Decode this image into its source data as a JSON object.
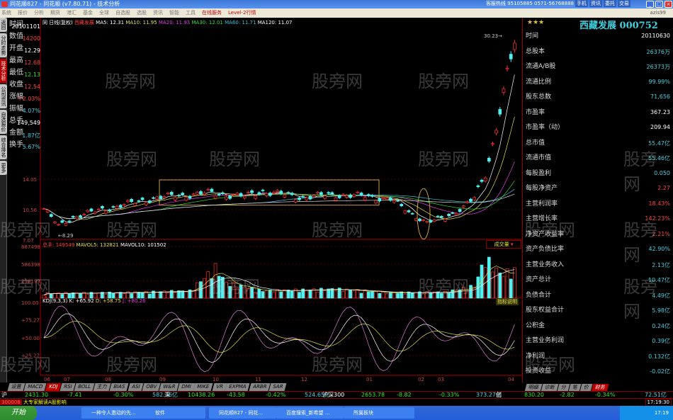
{
  "window": {
    "title": "同花顺827 - 同花顺 (v7.80.71) - 技术分析",
    "hotline": "客服热线 95105885 0571-56768888",
    "top_buttons": [
      "手机",
      "资讯",
      "委托",
      "交易"
    ],
    "user": "azis99"
  },
  "menu": [
    "系统",
    "报价",
    "分析",
    "期货",
    "港汇",
    "基金",
    "全球",
    "自选股",
    "选股",
    "资讯",
    "智能",
    "工具"
  ],
  "menu_hot": [
    "在线服务",
    "Level-2行情"
  ],
  "sidebar_tabs": [
    "返回",
    "分时走势",
    "技术分析",
    "公司资讯",
    "自选报价",
    "综合排名",
    "更多"
  ],
  "info": [
    {
      "label": "时间",
      "value": "20101101",
      "color": "#ffffff"
    },
    {
      "label": "数值",
      "value": "14200",
      "color": "#ff4040"
    },
    {
      "label": "开盘",
      "value": "12.29",
      "color": "#ffffff"
    },
    {
      "label": "最高",
      "value": "12.68",
      "color": "#ff4040"
    },
    {
      "label": "最低",
      "value": "12.13",
      "color": "#30e030"
    },
    {
      "label": "收盘",
      "value": "12.54",
      "color": "#ff4040"
    },
    {
      "label": "涨幅",
      "value": "+2.03%",
      "color": "#ff4040"
    },
    {
      "label": "振幅",
      "value": "4.07%",
      "color": "#40d0e0"
    },
    {
      "label": "总手",
      "value": "149,549",
      "color": "#ffffff"
    },
    {
      "label": "金额",
      "value": "1.87亿",
      "color": "#40d0e0"
    },
    {
      "label": "换手",
      "value": "5.67%",
      "color": "#40d0e0"
    }
  ],
  "chart_header": {
    "prefix": "同",
    "period": "日线(复权)",
    "stock": "西藏发展",
    "ma": [
      {
        "label": "MA5: 12.31",
        "color": "#ffffff"
      },
      {
        "label": "MA10: 11.95",
        "color": "#e0e040"
      },
      {
        "label": "MA20: 11.93",
        "color": "#e040e0"
      },
      {
        "label": "MA30: 12.01",
        "color": "#30e030"
      },
      {
        "label": "MA60: 11.71",
        "color": "#40c0e0"
      },
      {
        "label": "MA120: 11.07",
        "color": "#ffffff"
      }
    ]
  },
  "chart_data": {
    "type": "candlestick",
    "price_axis": [
      "14.05",
      "10.56",
      "7.07"
    ],
    "low_label": "8.29",
    "high_label": "30.23",
    "keypoints": [
      [
        0,
        10.6
      ],
      [
        4,
        8.6
      ],
      [
        8,
        9.6
      ],
      [
        15,
        10.4
      ],
      [
        25,
        11.3
      ],
      [
        30,
        11.8
      ],
      [
        45,
        12.4
      ],
      [
        55,
        12.0
      ],
      [
        60,
        12.6
      ],
      [
        70,
        11.9
      ],
      [
        80,
        12.2
      ],
      [
        88,
        12.0
      ],
      [
        95,
        11.7
      ],
      [
        100,
        10.2
      ],
      [
        105,
        9.0
      ],
      [
        110,
        9.6
      ],
      [
        115,
        10.8
      ],
      [
        118,
        11.8
      ],
      [
        121,
        14.5
      ],
      [
        123,
        18
      ],
      [
        125,
        22
      ],
      [
        127,
        26
      ],
      [
        129,
        29.5
      ]
    ],
    "volume_keypoints": [
      [
        0,
        80000
      ],
      [
        20,
        90000
      ],
      [
        40,
        120000
      ],
      [
        47,
        500000
      ],
      [
        50,
        250000
      ],
      [
        60,
        120000
      ],
      [
        80,
        150000
      ],
      [
        95,
        90000
      ],
      [
        110,
        100000
      ],
      [
        118,
        200000
      ],
      [
        121,
        650000
      ],
      [
        125,
        400000
      ],
      [
        129,
        450000
      ]
    ],
    "months": [
      "06",
      "07",
      "08",
      "09",
      "10",
      "11",
      "12",
      "01",
      "02",
      "03",
      "04"
    ],
    "volume_header": {
      "total": "总手: 149549",
      "mavol5": "MAVOL5: 132821",
      "mavol10": "MAVOL10: 101502",
      "axis": [
        "887498",
        "586398",
        "298199"
      ],
      "dropdown": "成交量"
    },
    "kdj_header": {
      "name": "KDJ(9,3,3)",
      "k": "K: +65.92",
      "d": "D: +58.75",
      "j": "J: +80.26",
      "axis": [
        "100.00",
        "+75.27",
        "+50.00",
        "+25.27"
      ],
      "button": "指标说明"
    }
  },
  "right_panel": {
    "stars": "★★★",
    "title": "西藏发展 000752",
    "rows": [
      {
        "label": "时间",
        "value": "20110630",
        "color": "#ffffff"
      },
      {
        "label": "总股本",
        "value": "26376万",
        "color": "#40d0e0"
      },
      {
        "label": "流通A/B股",
        "value": "26373万",
        "color": "#40d0e0"
      },
      {
        "label": "流通比例",
        "value": "99.99%",
        "color": "#40d0e0"
      },
      {
        "label": "股东总数",
        "value": "71,656",
        "color": "#40d0e0"
      },
      {
        "label": "市盈率",
        "value": "367.23",
        "color": "#ffffff"
      },
      {
        "label": "市盈率（动）",
        "value": "209.94",
        "color": "#ffffff"
      },
      {
        "label": "总市值",
        "value": "55.47亿",
        "color": "#40d0e0"
      },
      {
        "label": "流通市值",
        "value": "55.46亿",
        "color": "#40d0e0"
      },
      {
        "label": "每股盈利",
        "value": "0.050",
        "color": "#40d0e0"
      },
      {
        "label": "每股净资产",
        "value": "2.27",
        "color": "#ff4040"
      },
      {
        "label": "主营利润率",
        "value": "18.43%",
        "color": "#ff4040"
      },
      {
        "label": "主营增长率",
        "value": "142.23%",
        "color": "#ff4040"
      },
      {
        "label": "净资产收益率",
        "value": "2.21%",
        "color": "#ff4040"
      },
      {
        "label": "资产负债比率",
        "value": "42.90%",
        "color": "#40d0e0"
      },
      {
        "label": "主营业务收入",
        "value": "2.13亿",
        "color": "#40d0e0"
      },
      {
        "label": "资产总计",
        "value": "10.47亿",
        "color": "#40d0e0"
      },
      {
        "label": "负债合计",
        "value": "4.49亿",
        "color": "#40d0e0"
      },
      {
        "label": "股东权益合计",
        "value": "5.98亿",
        "color": "#40d0e0"
      },
      {
        "label": "公积金",
        "value": "0.24亿",
        "color": "#40d0e0"
      },
      {
        "label": "主营业务利润",
        "value": "0.39亿",
        "color": "#40d0e0"
      },
      {
        "label": "净利润",
        "value": "0.132亿",
        "color": "#40d0e0"
      },
      {
        "label": "投资收益",
        "value": "-0.02亿",
        "color": "#40d0e0"
      }
    ],
    "tabs": [
      "明细",
      "诊断",
      "分",
      "笔",
      "价",
      "财务"
    ]
  },
  "indicator_tabs": [
    "设置",
    "MACD",
    "KDJ",
    "RSI",
    "BOLL",
    "主力",
    "BIAS",
    "ASI",
    "OBV",
    "W&R",
    "DMI",
    "MIKE",
    "VR",
    "EXPMA",
    "ARBR",
    "SAR"
  ],
  "index_bar": [
    {
      "text": "沪",
      "color": "#ffffff"
    },
    {
      "text": "2431.30",
      "color": "#30e030"
    },
    {
      "text": "-7.41",
      "color": "#30e030"
    },
    {
      "text": "-0.30%",
      "color": "#30e030"
    },
    {
      "text": "582.76亿",
      "color": "#40d0e0"
    },
    {
      "text": "深",
      "color": "#ffffff"
    },
    {
      "text": "10438.26",
      "color": "#30e030"
    },
    {
      "text": "-43.58",
      "color": "#30e030"
    },
    {
      "text": "-0.42%",
      "color": "#30e030"
    },
    {
      "text": "524.65亿",
      "color": "#40d0e0"
    },
    {
      "text": "沪深300",
      "color": "#ffffff"
    },
    {
      "text": "2653.78",
      "color": "#30e030"
    },
    {
      "text": "-8.82",
      "color": "#30e030"
    },
    {
      "text": "-0.33%",
      "color": "#30e030"
    },
    {
      "text": "373.27亿",
      "color": "#40d0e0"
    },
    {
      "text": "创",
      "color": "#ffffff"
    },
    {
      "text": "830.20",
      "color": "#30e030"
    },
    {
      "text": "-2.82",
      "color": "#30e030"
    },
    {
      "text": "-0.34%",
      "color": "#30e030"
    },
    {
      "text": "72.51亿",
      "color": "#40d0e0"
    }
  ],
  "news": {
    "code": "300008",
    "text": "大专家解读A股影响"
  },
  "clock": "17:19:30",
  "taskbar": {
    "start": "开始",
    "tasks": [
      "一种令人激动的先...",
      "软件",
      "同花顺827 - 同花...",
      "百度搜索_新希望 ...",
      "所属板块"
    ],
    "time": "17:19"
  },
  "watermark": "股旁网"
}
